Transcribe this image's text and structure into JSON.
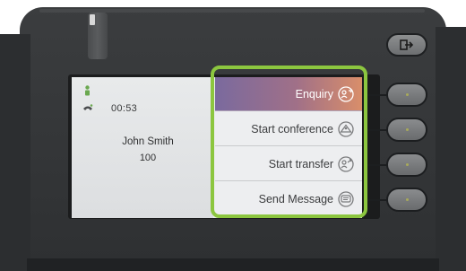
{
  "call": {
    "duration": "00:53",
    "caller_name": "John Smith",
    "caller_number": "100"
  },
  "menu": {
    "items": [
      {
        "label": "Enquiry",
        "icon": "enquiry-icon",
        "selected": true
      },
      {
        "label": "Start conference",
        "icon": "conference-icon",
        "selected": false
      },
      {
        "label": "Start transfer",
        "icon": "transfer-icon",
        "selected": false
      },
      {
        "label": "Send Message",
        "icon": "message-icon",
        "selected": false
      }
    ]
  },
  "colors": {
    "highlight": "#8cc63f",
    "selected_gradient_start": "#7a6a9e",
    "selected_gradient_end": "#d98e6a",
    "status_green": "#6aa84f"
  }
}
